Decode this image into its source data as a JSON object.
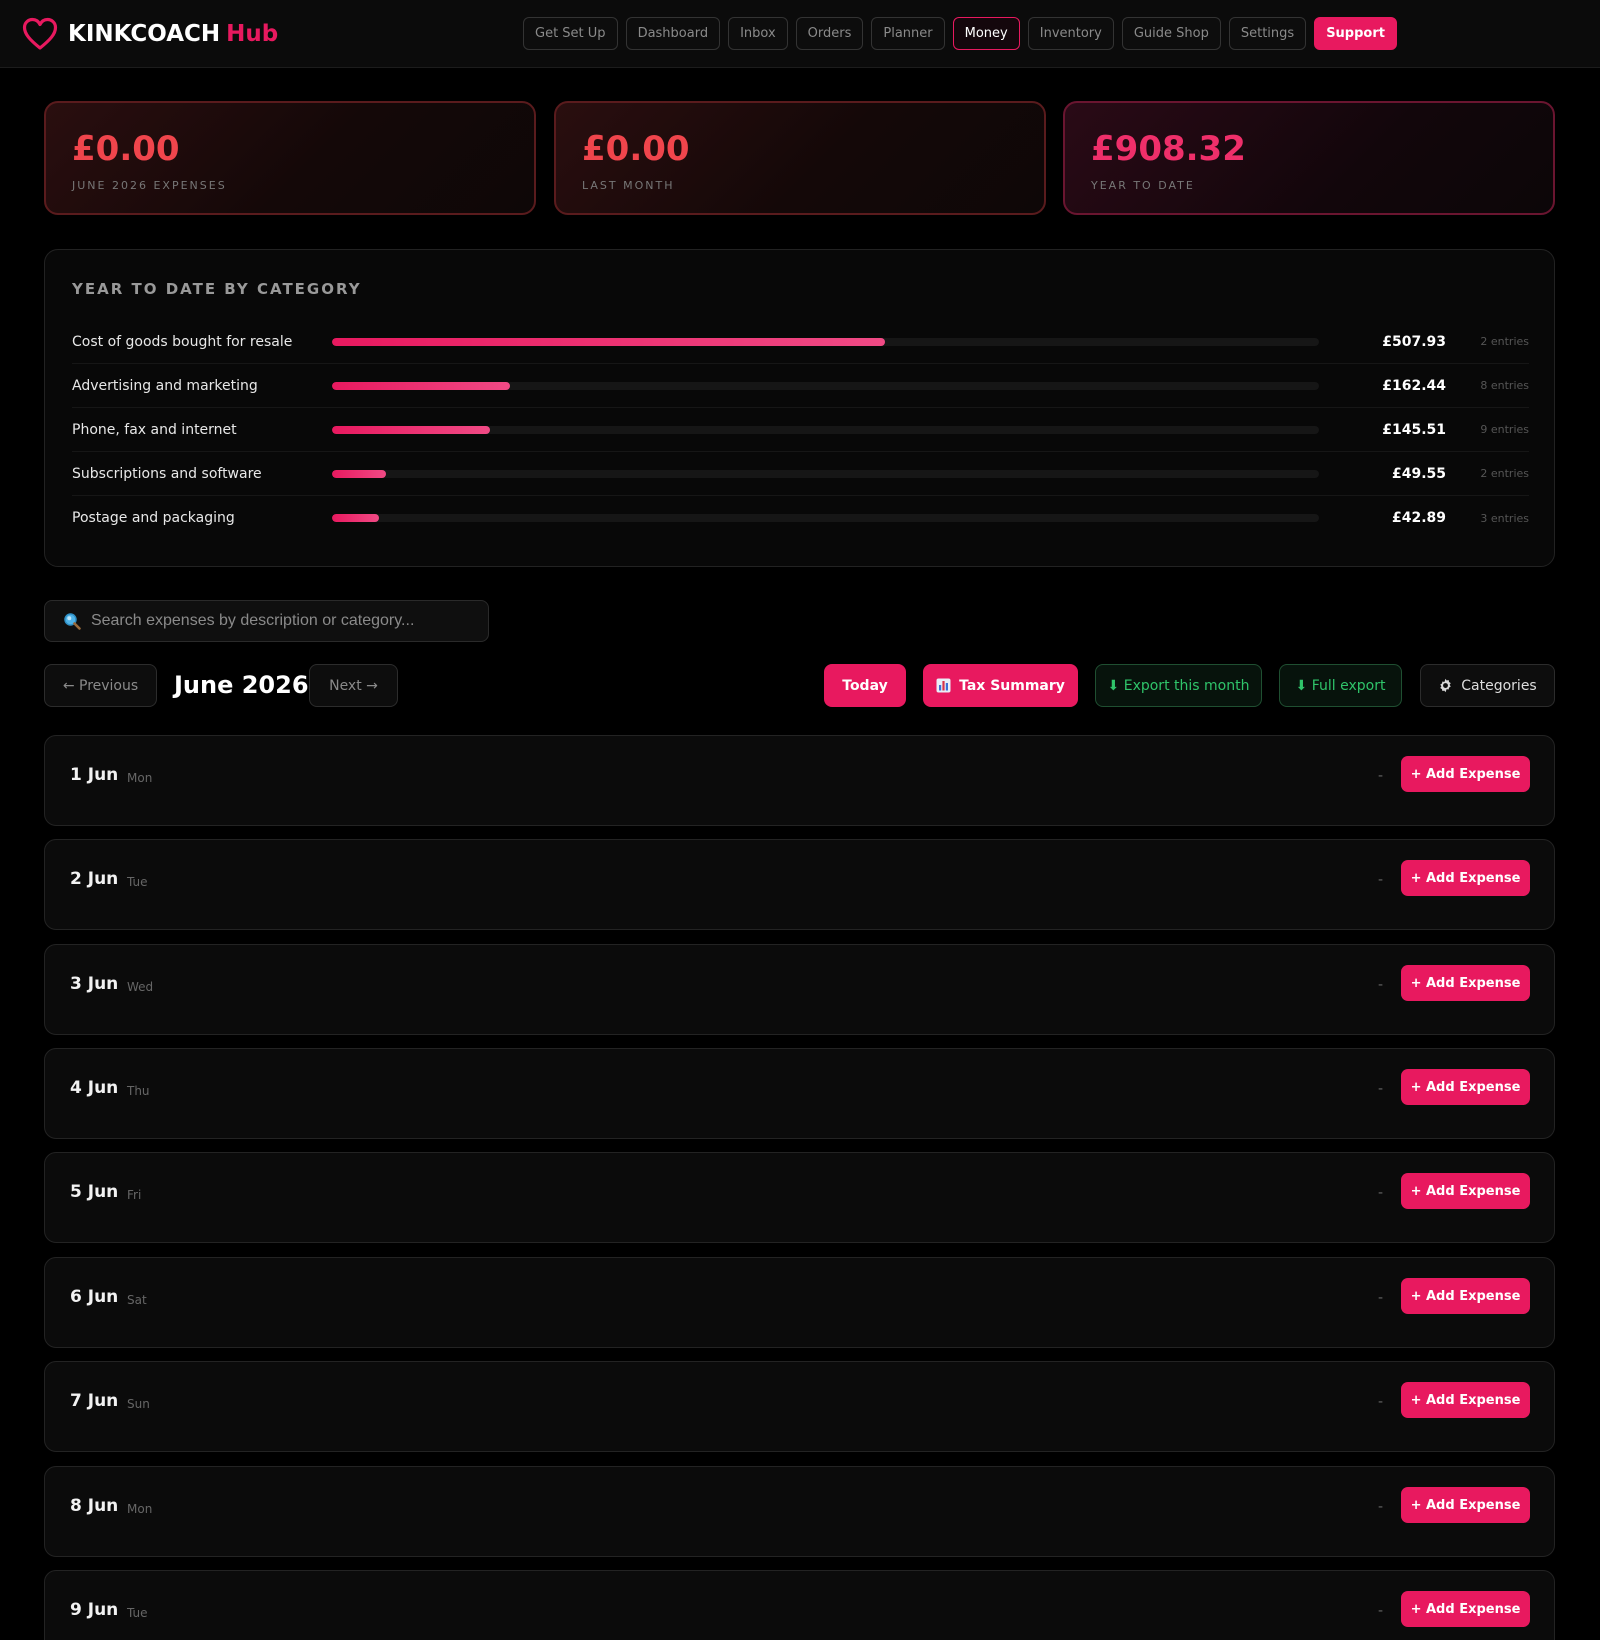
{
  "brand": {
    "name": "KINKCOACH",
    "suffix": "Hub",
    "accent": "#e8195f"
  },
  "nav": {
    "items": [
      {
        "label": "Get Set Up"
      },
      {
        "label": "Dashboard"
      },
      {
        "label": "Inbox"
      },
      {
        "label": "Orders"
      },
      {
        "label": "Planner"
      },
      {
        "label": "Money",
        "active": true
      },
      {
        "label": "Inventory"
      },
      {
        "label": "Guide Shop"
      },
      {
        "label": "Settings"
      },
      {
        "label": "Support",
        "highlight": true
      }
    ]
  },
  "stats": {
    "month": {
      "value": "£0.00",
      "label": "JUNE 2026 EXPENSES"
    },
    "last_month": {
      "value": "£0.00",
      "label": "LAST MONTH"
    },
    "ytd": {
      "value": "£908.32",
      "label": "YEAR TO DATE"
    }
  },
  "categories": {
    "title": "YEAR TO DATE BY CATEGORY",
    "items": [
      {
        "name": "Cost of goods bought for resale",
        "amount": "£507.93",
        "entries": "2 entries",
        "fill": 0.56
      },
      {
        "name": "Advertising and marketing",
        "amount": "£162.44",
        "entries": "8 entries",
        "fill": 0.18
      },
      {
        "name": "Phone, fax and internet",
        "amount": "£145.51",
        "entries": "9 entries",
        "fill": 0.16
      },
      {
        "name": "Subscriptions and software",
        "amount": "£49.55",
        "entries": "2 entries",
        "fill": 0.055
      },
      {
        "name": "Postage and packaging",
        "amount": "£42.89",
        "entries": "3 entries",
        "fill": 0.048
      }
    ]
  },
  "search": {
    "placeholder": "Search expenses by description or category...",
    "icon": "search-icon"
  },
  "toolbar": {
    "previous": "← Previous",
    "month": "June 2026",
    "next": "Next →",
    "today": "Today",
    "tax_summary": "Tax Summary",
    "export_month": "⬇ Export this month",
    "full_export": "⬇ Full export",
    "categories": "Categories"
  },
  "days": [
    {
      "date": "1 Jun",
      "dow": "Mon",
      "total": "-",
      "action": "+ Add Expense"
    },
    {
      "date": "2 Jun",
      "dow": "Tue",
      "total": "-",
      "action": "+ Add Expense"
    },
    {
      "date": "3 Jun",
      "dow": "Wed",
      "total": "-",
      "action": "+ Add Expense"
    },
    {
      "date": "4 Jun",
      "dow": "Thu",
      "total": "-",
      "action": "+ Add Expense"
    },
    {
      "date": "5 Jun",
      "dow": "Fri",
      "total": "-",
      "action": "+ Add Expense"
    },
    {
      "date": "6 Jun",
      "dow": "Sat",
      "total": "-",
      "action": "+ Add Expense"
    },
    {
      "date": "7 Jun",
      "dow": "Sun",
      "total": "-",
      "action": "+ Add Expense"
    },
    {
      "date": "8 Jun",
      "dow": "Mon",
      "total": "-",
      "action": "+ Add Expense"
    },
    {
      "date": "9 Jun",
      "dow": "Tue",
      "total": "-",
      "action": "+ Add Expense"
    }
  ]
}
